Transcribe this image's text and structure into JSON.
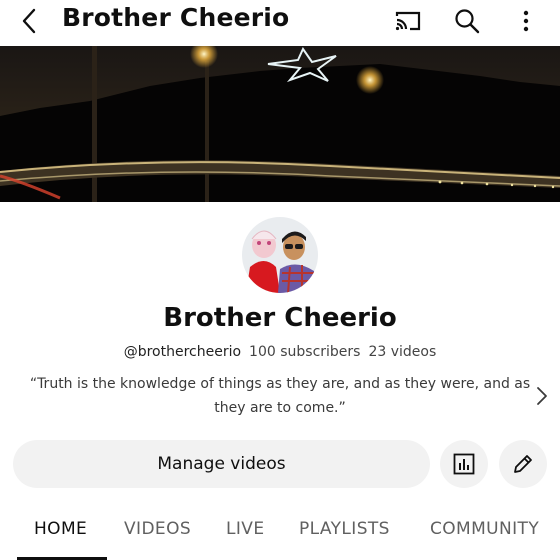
{
  "header": {
    "title": "Brother Cheerio",
    "icons": [
      "back-arrow-icon",
      "cast-icon",
      "search-icon",
      "more-vert-icon"
    ]
  },
  "channel": {
    "name": "Brother Cheerio",
    "handle": "@brothercheerio",
    "subscribers": "100 subscribers",
    "videos": "23 videos",
    "description": "“Truth is the knowledge of things as they are, and as they were, and as they are to come.”"
  },
  "actions": {
    "manage_label": "Manage videos"
  },
  "tabs": [
    {
      "label": "HOME",
      "active": true
    },
    {
      "label": "VIDEOS",
      "active": false
    },
    {
      "label": "LIVE",
      "active": false
    },
    {
      "label": "PLAYLISTS",
      "active": false
    },
    {
      "label": "COMMUNITY",
      "active": false
    }
  ],
  "colors": {
    "text": "#0f0f0f",
    "secondary_text": "#606060",
    "button_bg": "#f2f2f2",
    "banner_bg": "#0b0a0c"
  }
}
